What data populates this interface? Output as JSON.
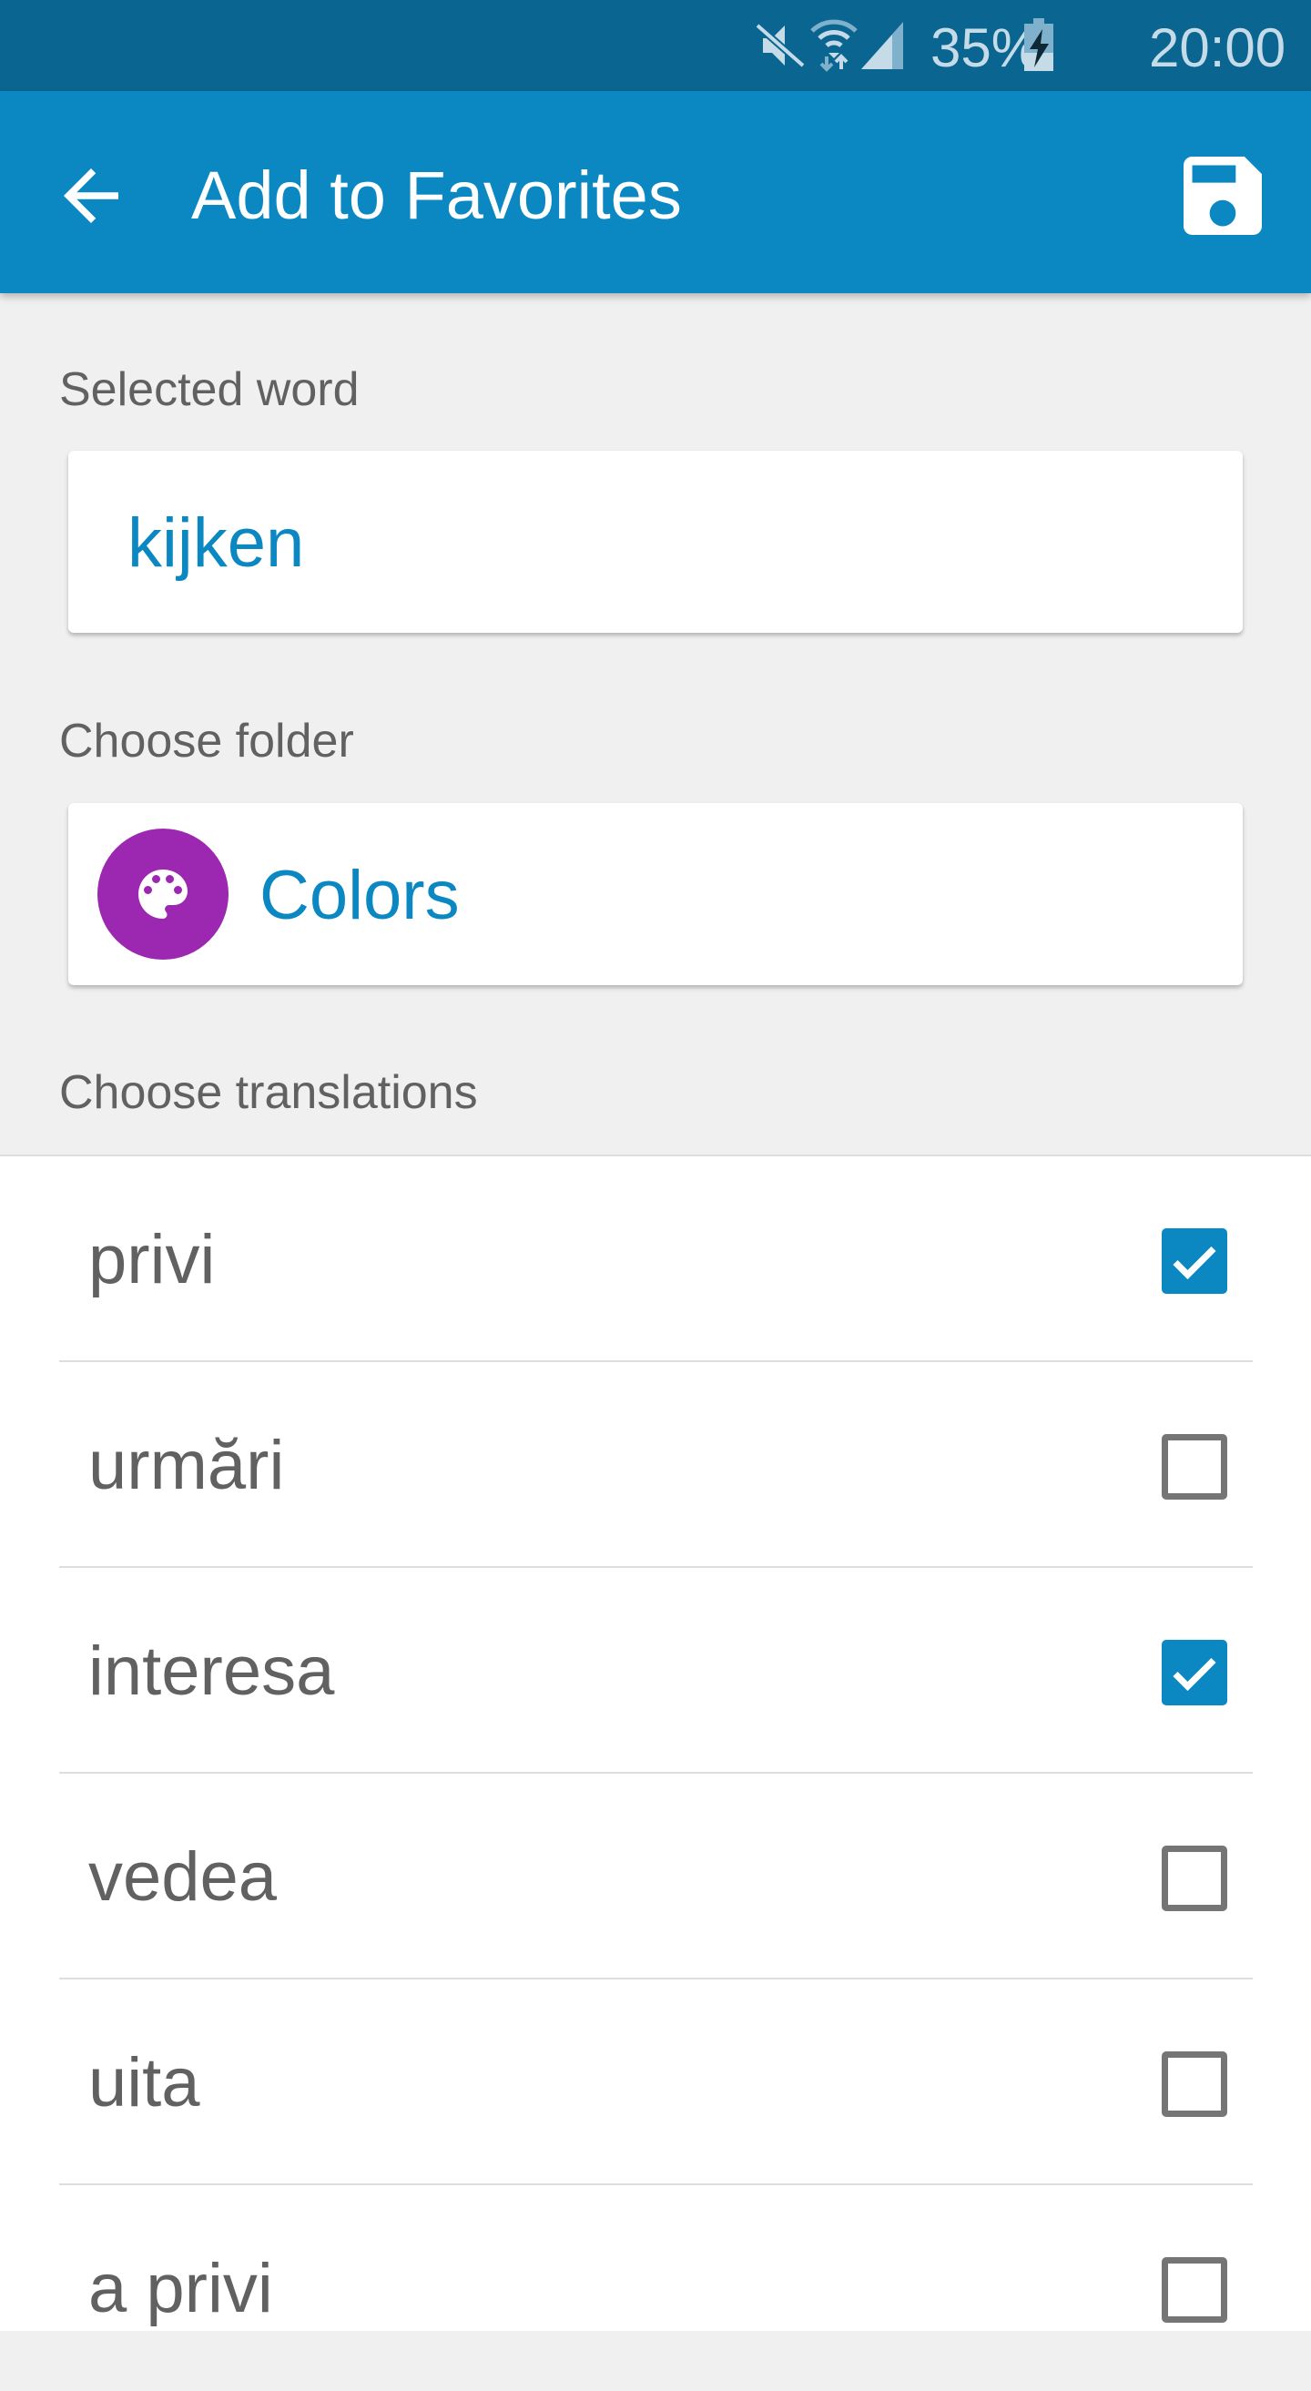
{
  "status_bar": {
    "battery": "35%",
    "time": "20:00",
    "icons": [
      "mute-icon",
      "wifi-icon",
      "signal-icon",
      "battery-charging-icon"
    ]
  },
  "app_bar": {
    "title": "Add to Favorites",
    "back_icon": "arrow-back-icon",
    "save_icon": "save-icon",
    "color": "#0b87c2"
  },
  "selected_word": {
    "label": "Selected word",
    "value": "kijken"
  },
  "folder": {
    "label": "Choose folder",
    "value": "Colors",
    "icon": "palette-icon",
    "icon_color": "#9c27b0"
  },
  "translations": {
    "label": "Choose translations",
    "items": [
      {
        "text": "privi",
        "checked": true
      },
      {
        "text": "urmări",
        "checked": false
      },
      {
        "text": "interesa",
        "checked": true
      },
      {
        "text": "vedea",
        "checked": false
      },
      {
        "text": "uita",
        "checked": false
      },
      {
        "text": "a privi",
        "checked": false
      }
    ]
  }
}
